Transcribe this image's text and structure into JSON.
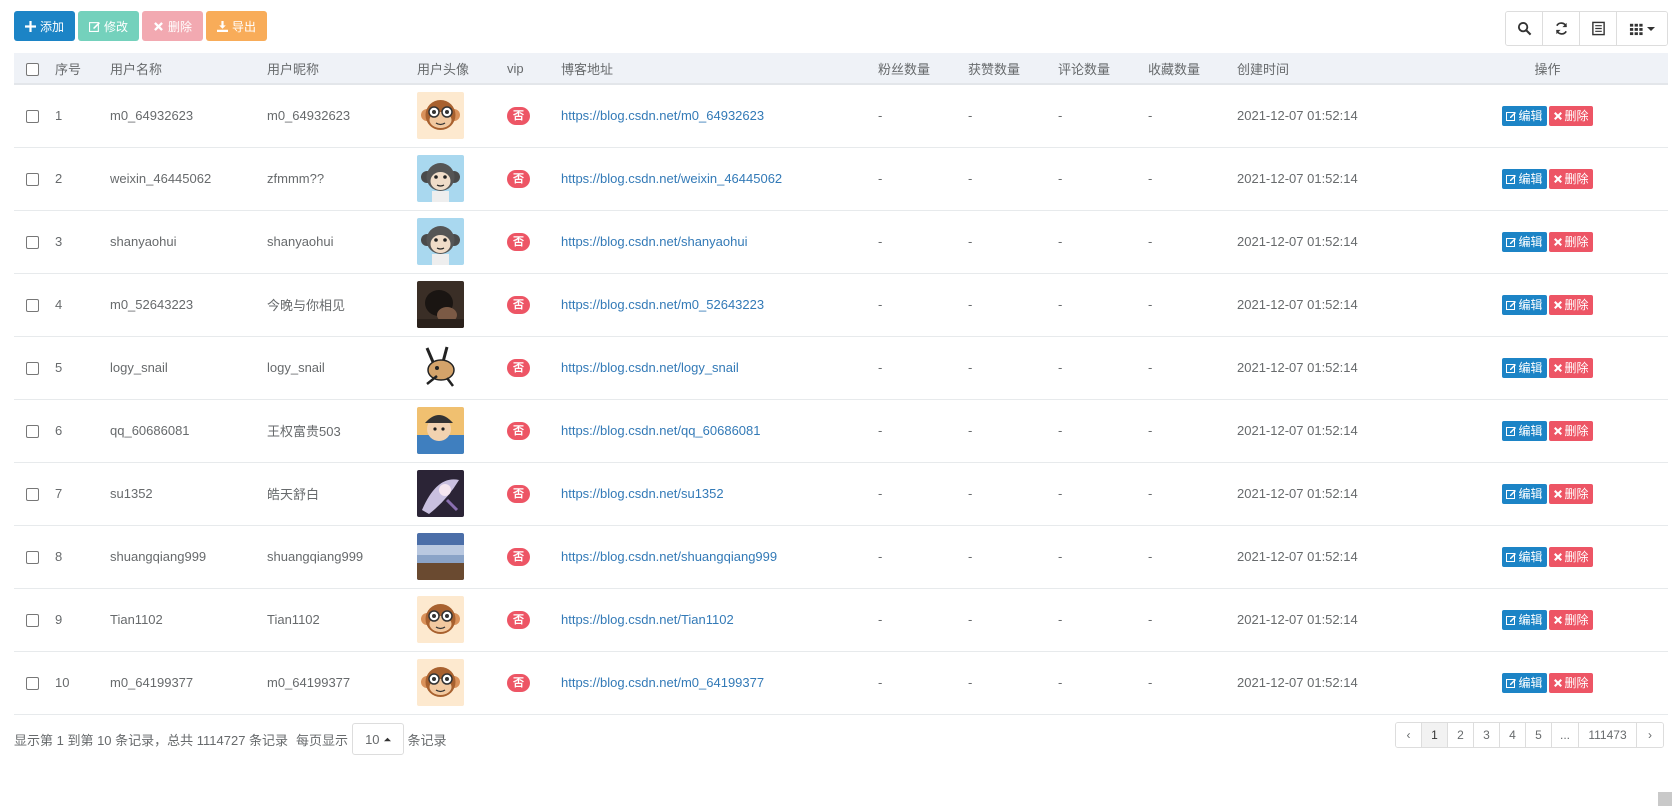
{
  "toolbar": {
    "add_label": "添加",
    "edit_label": "修改",
    "delete_label": "删除",
    "export_label": "导出"
  },
  "right_tools": [
    "search-icon",
    "refresh-icon",
    "columns-icon",
    "grid-icon"
  ],
  "table": {
    "headers": [
      "序号",
      "用户名称",
      "用户昵称",
      "用户头像",
      "vip",
      "博客地址",
      "粉丝数量",
      "获赞数量",
      "评论数量",
      "收藏数量",
      "创建时间",
      "操作"
    ],
    "rows": [
      {
        "no": "1",
        "username": "m0_64932623",
        "nickname": "m0_64932623",
        "avatar": "monkey-glasses",
        "vip": "否",
        "url": "https://blog.csdn.net/m0_64932623",
        "fans": "-",
        "likes": "-",
        "comments": "-",
        "favs": "-",
        "created": "2021-12-07 01:52:14",
        "edit": "编辑",
        "del": "删除"
      },
      {
        "no": "2",
        "username": "weixin_46445062",
        "nickname": "zfmmm??",
        "avatar": "monkey-blue",
        "vip": "否",
        "url": "https://blog.csdn.net/weixin_46445062",
        "fans": "-",
        "likes": "-",
        "comments": "-",
        "favs": "-",
        "created": "2021-12-07 01:52:14",
        "edit": "编辑",
        "del": "删除"
      },
      {
        "no": "3",
        "username": "shanyaohui",
        "nickname": "shanyaohui",
        "avatar": "monkey-blue",
        "vip": "否",
        "url": "https://blog.csdn.net/shanyaohui",
        "fans": "-",
        "likes": "-",
        "comments": "-",
        "favs": "-",
        "created": "2021-12-07 01:52:14",
        "edit": "编辑",
        "del": "删除"
      },
      {
        "no": "4",
        "username": "m0_52643223",
        "nickname": "今晚与你相见",
        "avatar": "dark-photo",
        "vip": "否",
        "url": "https://blog.csdn.net/m0_52643223",
        "fans": "-",
        "likes": "-",
        "comments": "-",
        "favs": "-",
        "created": "2021-12-07 01:52:14",
        "edit": "编辑",
        "del": "删除"
      },
      {
        "no": "5",
        "username": "logy_snail",
        "nickname": "logy_snail",
        "avatar": "cartoon-animal",
        "vip": "否",
        "url": "https://blog.csdn.net/logy_snail",
        "fans": "-",
        "likes": "-",
        "comments": "-",
        "favs": "-",
        "created": "2021-12-07 01:52:14",
        "edit": "编辑",
        "del": "删除"
      },
      {
        "no": "6",
        "username": "qq_60686081",
        "nickname": "王权富贵503",
        "avatar": "anime-character",
        "vip": "否",
        "url": "https://blog.csdn.net/qq_60686081",
        "fans": "-",
        "likes": "-",
        "comments": "-",
        "favs": "-",
        "created": "2021-12-07 01:52:14",
        "edit": "编辑",
        "del": "删除"
      },
      {
        "no": "7",
        "username": "su1352",
        "nickname": "皓天舒白",
        "avatar": "anime-art",
        "vip": "否",
        "url": "https://blog.csdn.net/su1352",
        "fans": "-",
        "likes": "-",
        "comments": "-",
        "favs": "-",
        "created": "2021-12-07 01:52:14",
        "edit": "编辑",
        "del": "删除"
      },
      {
        "no": "8",
        "username": "shuangqiang999",
        "nickname": "shuangqiang999",
        "avatar": "landscape",
        "vip": "否",
        "url": "https://blog.csdn.net/shuangqiang999",
        "fans": "-",
        "likes": "-",
        "comments": "-",
        "favs": "-",
        "created": "2021-12-07 01:52:14",
        "edit": "编辑",
        "del": "删除"
      },
      {
        "no": "9",
        "username": "Tian1102",
        "nickname": "Tian1102",
        "avatar": "monkey-glasses",
        "vip": "否",
        "url": "https://blog.csdn.net/Tian1102",
        "fans": "-",
        "likes": "-",
        "comments": "-",
        "favs": "-",
        "created": "2021-12-07 01:52:14",
        "edit": "编辑",
        "del": "删除"
      },
      {
        "no": "10",
        "username": "m0_64199377",
        "nickname": "m0_64199377",
        "avatar": "monkey-glasses",
        "vip": "否",
        "url": "https://blog.csdn.net/m0_64199377",
        "fans": "-",
        "likes": "-",
        "comments": "-",
        "favs": "-",
        "created": "2021-12-07 01:52:14",
        "edit": "编辑",
        "del": "删除"
      }
    ]
  },
  "footer": {
    "summary": "显示第 1 到第 10 条记录，总共 1114727 条记录",
    "per_page_prefix": "每页显示",
    "page_size": "10",
    "per_page_suffix": "条记录",
    "pages": [
      "‹",
      "1",
      "2",
      "3",
      "4",
      "5",
      "...",
      "111473",
      "›"
    ],
    "active_page": "1"
  },
  "colors": {
    "primary": "#1c84c6",
    "danger": "#ed5565",
    "success_light": "#74d1bc",
    "danger_light": "#f2a9b1",
    "warning": "#f8ac59",
    "link": "#337ab7"
  }
}
